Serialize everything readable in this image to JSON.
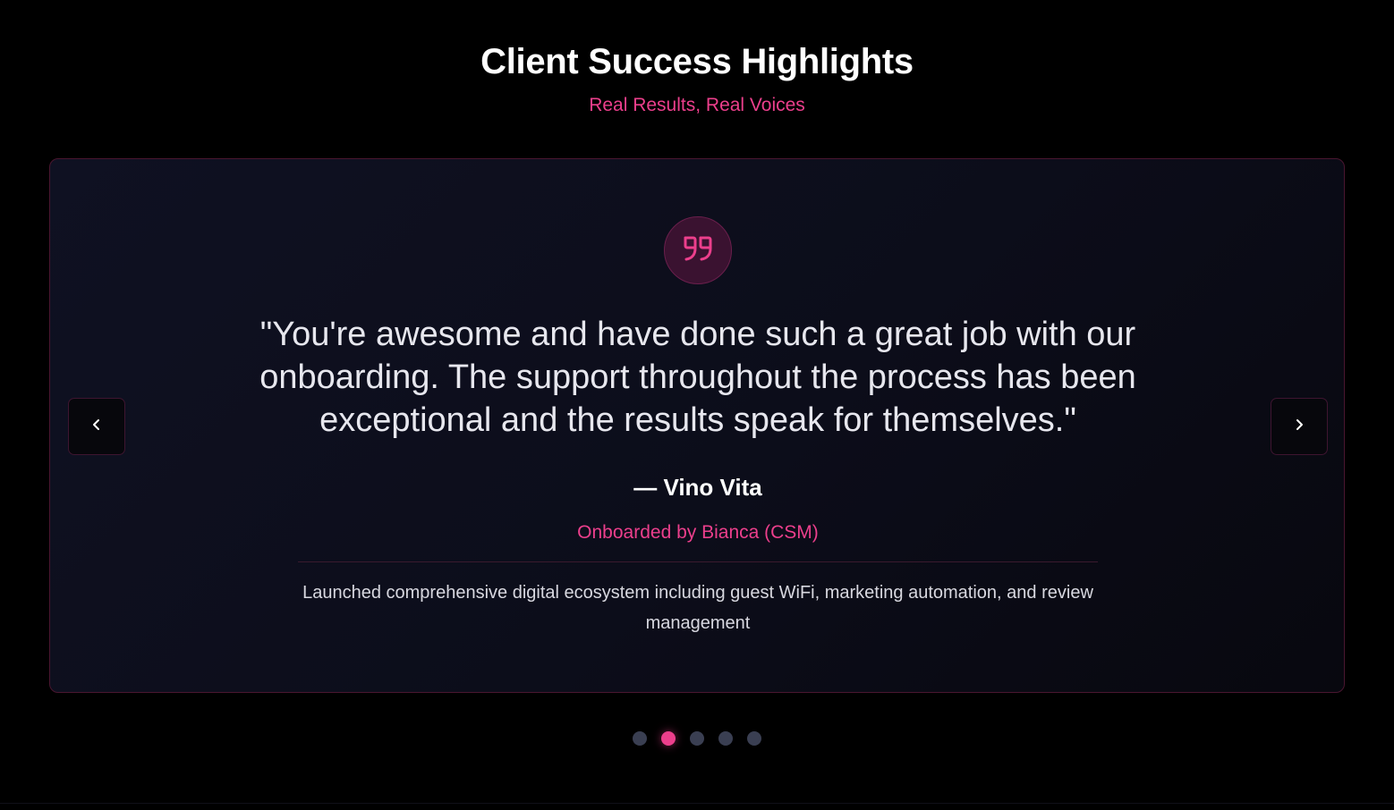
{
  "header": {
    "title": "Client Success Highlights",
    "subtitle": "Real Results, Real Voices"
  },
  "testimonial": {
    "quote": "\"You're awesome and have done such a great job with our onboarding. The support throughout the process has been exceptional and the results speak for themselves.\"",
    "author": "— Vino Vita",
    "onboarded_by": "Onboarded by Bianca (CSM)",
    "result": "Launched comprehensive digital ecosystem including guest WiFi, marketing automation, and review management"
  },
  "carousel": {
    "slide_count": 5,
    "active_index": 1,
    "prev_icon": "chevron-left-icon",
    "next_icon": "chevron-right-icon",
    "quote_icon": "quote-icon"
  },
  "colors": {
    "accent": "#ec3f8c",
    "background": "#000000",
    "card_background": "#0d0f1d",
    "dot_inactive": "#3a3f52"
  }
}
